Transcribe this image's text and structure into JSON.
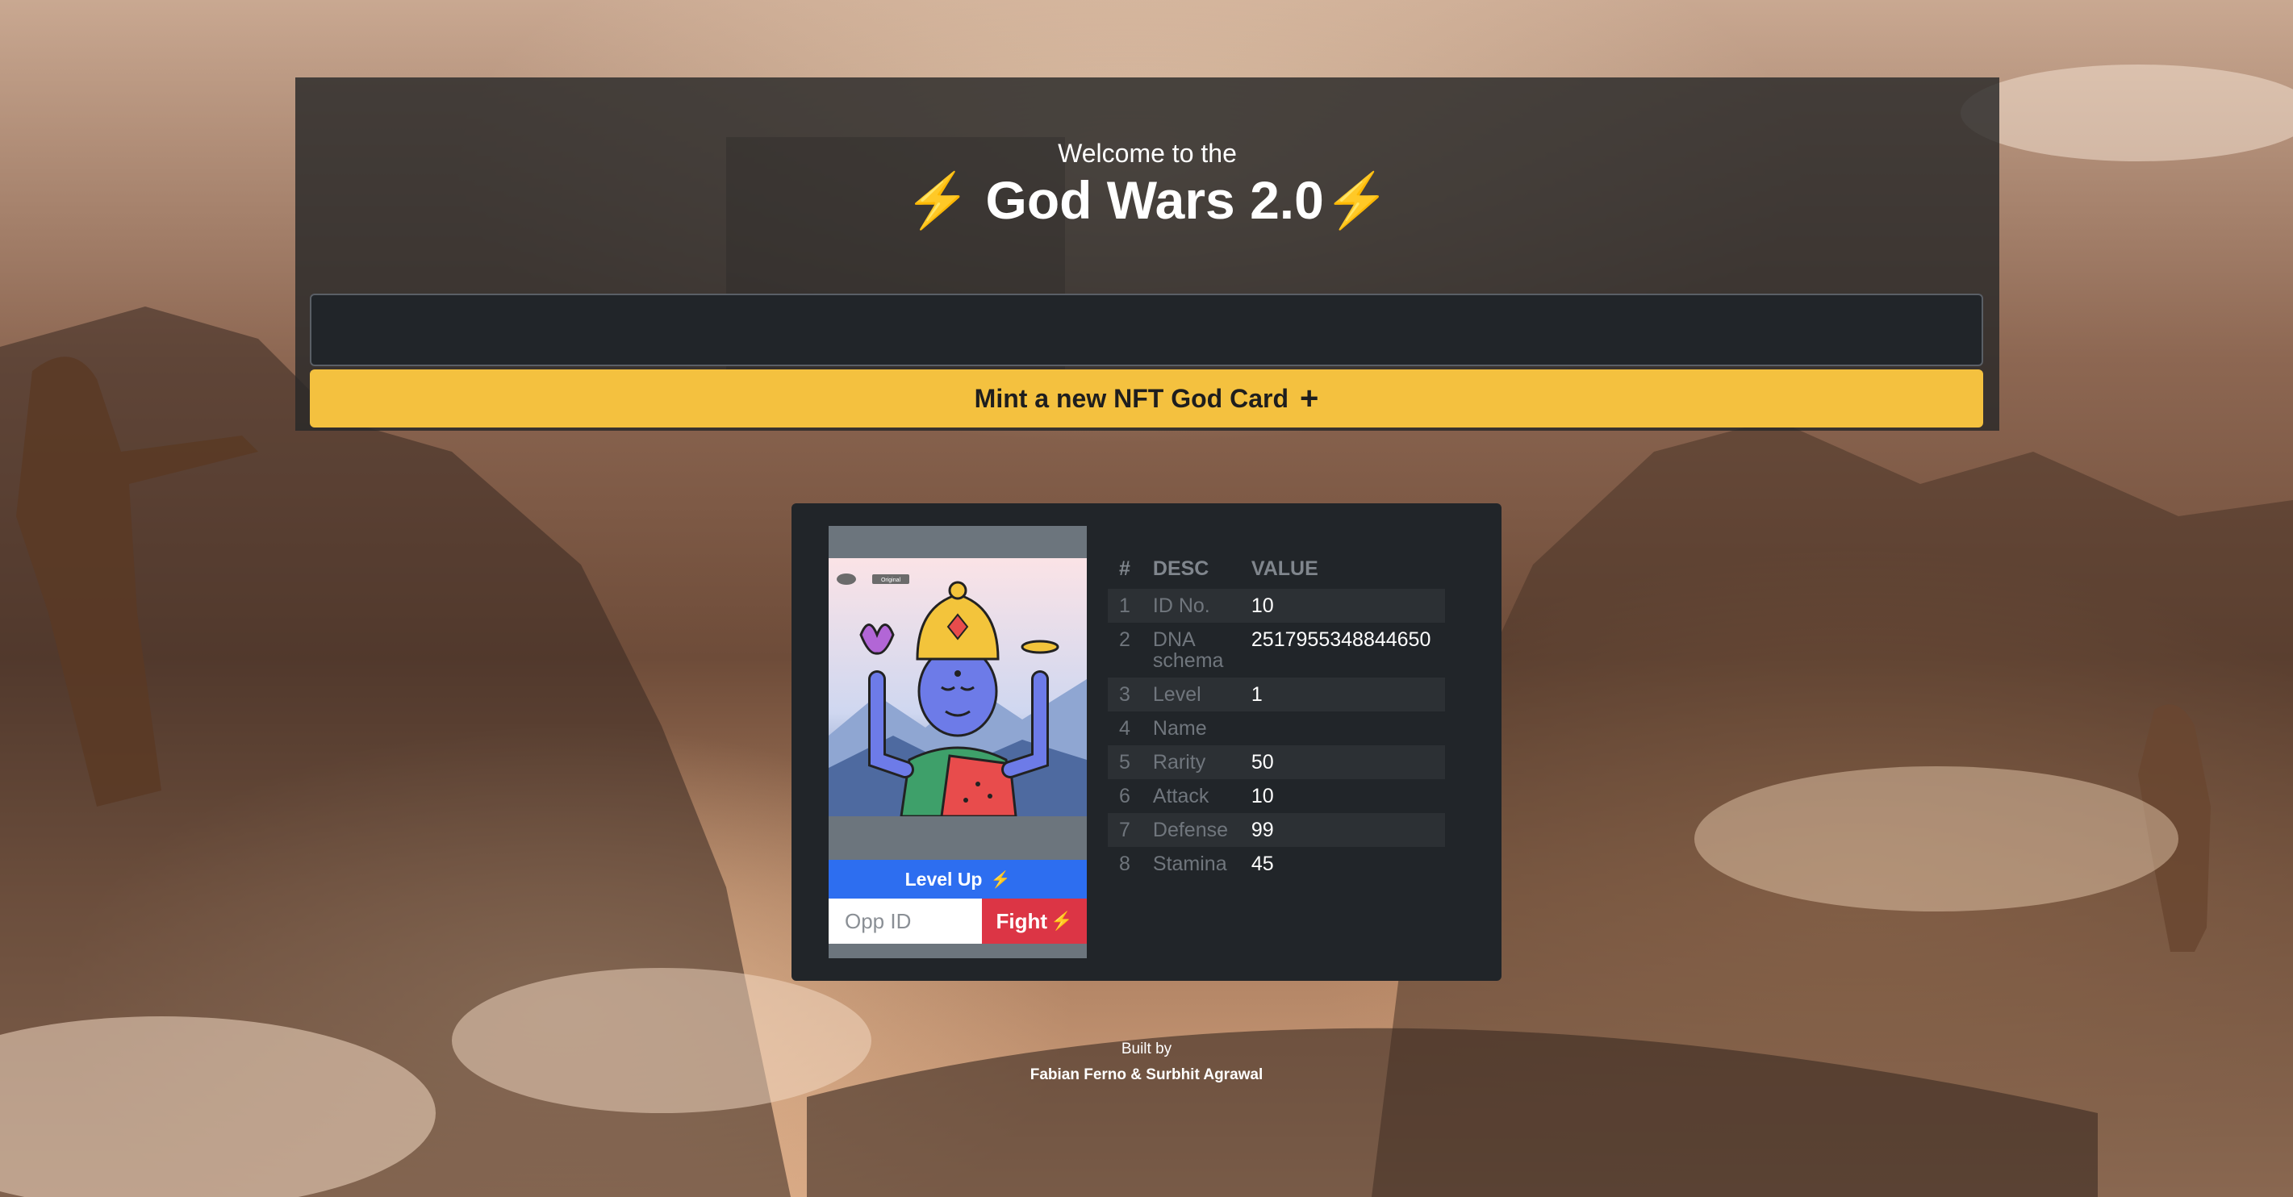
{
  "header": {
    "welcome": "Welcome to the",
    "title": "God Wars 2.0",
    "title_icon": "lightning-icon"
  },
  "mint": {
    "input_value": "",
    "button_label": "Mint a new NFT God Card",
    "button_icon": "plus-icon"
  },
  "card": {
    "image_badge": "Original",
    "level_up_label": "Level Up",
    "opp_id_placeholder": "Opp ID",
    "fight_label": "Fight",
    "stats_headers": {
      "index": "#",
      "desc": "DESC",
      "value": "VALUE"
    },
    "stats": [
      {
        "index": "1",
        "desc": "ID No.",
        "value": "10"
      },
      {
        "index": "2",
        "desc": "DNA schema",
        "value": "2517955348844650"
      },
      {
        "index": "3",
        "desc": "Level",
        "value": "1"
      },
      {
        "index": "4",
        "desc": "Name",
        "value": ""
      },
      {
        "index": "5",
        "desc": "Rarity",
        "value": "50"
      },
      {
        "index": "6",
        "desc": "Attack",
        "value": "10"
      },
      {
        "index": "7",
        "desc": "Defense",
        "value": "99"
      },
      {
        "index": "8",
        "desc": "Stamina",
        "value": "45"
      }
    ]
  },
  "footer": {
    "built_by": "Built by",
    "authors": "Fabian Ferno & Surbhit Agrawal"
  },
  "colors": {
    "accent_yellow": "#f4c13f",
    "level_up_blue": "#2d6ef0",
    "fight_red": "#dc3545",
    "panel_dark": "#212529"
  }
}
